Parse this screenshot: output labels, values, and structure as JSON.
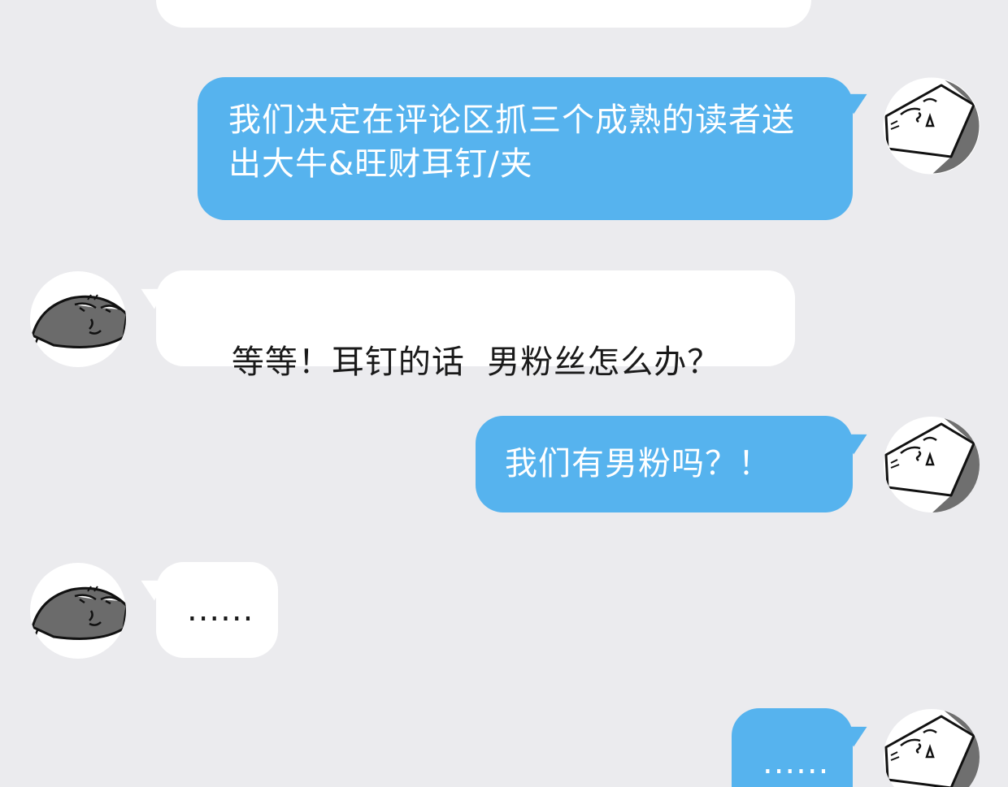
{
  "messages": [
    {
      "side": "in",
      "text": ""
    },
    {
      "side": "out",
      "text": "我们决定在评论区抓三个成熟的读者送出大牛&旺财耳钉/夹"
    },
    {
      "side": "in",
      "text": "等等！耳钉的话  男粉丝怎么办？"
    },
    {
      "side": "out",
      "text": "我们有男粉吗？！"
    },
    {
      "side": "in",
      "text": "......"
    },
    {
      "side": "out",
      "text": "......"
    }
  ],
  "colors": {
    "background": "#ebebee",
    "bubble_out": "#56b3ee",
    "bubble_in": "#ffffff"
  },
  "icons": {
    "self_avatar": "white-faced-cartoon-avatar-icon",
    "other_avatar": "dark-faced-cartoon-avatar-icon"
  }
}
